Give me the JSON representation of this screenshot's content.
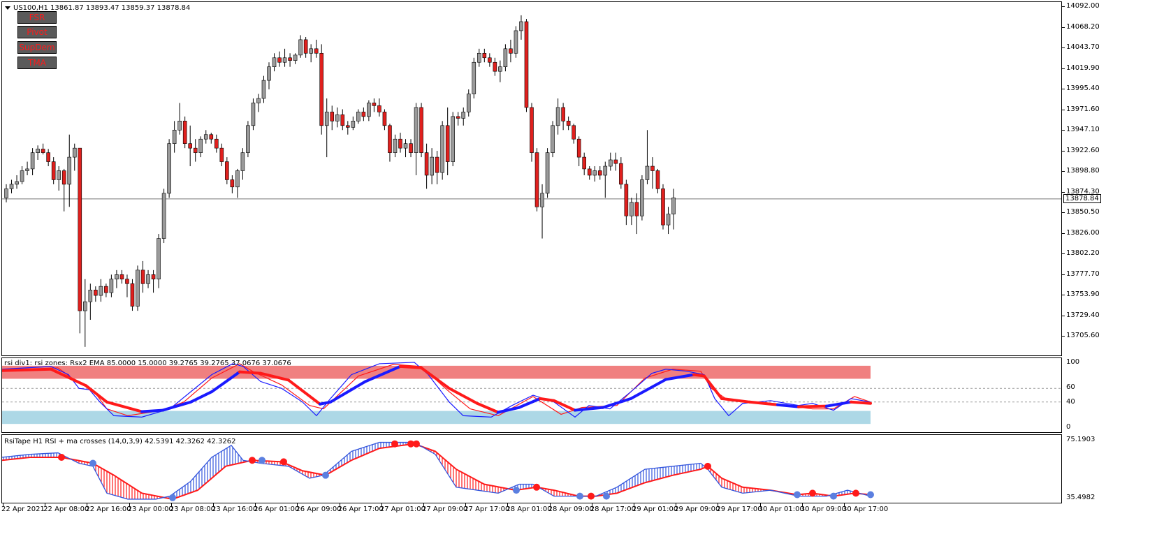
{
  "colors": {
    "bull_candle": "#9a9a9a",
    "bear_candle": "#e0201e",
    "rsx_up": "#1a1aff",
    "rsx_down": "#ff1a1a",
    "upper_zone": "#f08080",
    "lower_zone": "#add8e6",
    "rsi_line": "#3355dd",
    "ma_line": "#ff1a1a",
    "dot_blue": "#5b7fe0",
    "dot_red": "#ff1a1a"
  },
  "main": {
    "title": "US100,H1  13861.87 13893.47 13859.37 13878.84",
    "buttons": [
      "FSR",
      "Pivot",
      "SupDem",
      "TMA"
    ],
    "current_price": "13878.84",
    "y_labels": [
      "14092.00",
      "14068.20",
      "14043.70",
      "14019.90",
      "13995.40",
      "13971.60",
      "13947.10",
      "13922.60",
      "13898.80",
      "13874.30",
      "13850.50",
      "13826.00",
      "13802.20",
      "13777.70",
      "13753.90",
      "13729.40",
      "13705.60"
    ]
  },
  "ind1": {
    "title": "rsi div1: rsi zones: Rsx2 EMA 85.0000 15.0000 39.2765 39.2765 37.0676 37.0676",
    "y_labels": [
      "100",
      "60",
      "40",
      "0"
    ]
  },
  "ind2": {
    "title": "RsiTape H1 RSI + ma crosses (14,0,3,9) 42.5391 42.3262 42.3262",
    "y_labels": [
      "75.1903",
      "35.4982"
    ]
  },
  "x_labels": [
    "22 Apr 2021",
    "22 Apr 08:00",
    "22 Apr 16:00",
    "23 Apr 00:00",
    "23 Apr 08:00",
    "23 Apr 16:00",
    "26 Apr 01:00",
    "26 Apr 09:00",
    "26 Apr 17:00",
    "27 Apr 01:00",
    "27 Apr 09:00",
    "27 Apr 17:00",
    "28 Apr 01:00",
    "28 Apr 09:00",
    "28 Apr 17:00",
    "29 Apr 01:00",
    "29 Apr 09:00",
    "29 Apr 17:00",
    "30 Apr 01:00",
    "30 Apr 09:00",
    "30 Apr 17:00"
  ],
  "chart_data": {
    "type": "candlestick",
    "ohlc": [
      [
        13880,
        13895,
        13875,
        13890
      ],
      [
        13890,
        13900,
        13885,
        13895
      ],
      [
        13895,
        13905,
        13890,
        13898
      ],
      [
        13898,
        13915,
        13895,
        13910
      ],
      [
        13910,
        13920,
        13905,
        13912
      ],
      [
        13912,
        13935,
        13905,
        13930
      ],
      [
        13930,
        13938,
        13922,
        13934
      ],
      [
        13934,
        13940,
        13928,
        13930
      ],
      [
        13930,
        13934,
        13915,
        13920
      ],
      [
        13920,
        13925,
        13895,
        13900
      ],
      [
        13900,
        13915,
        13888,
        13910
      ],
      [
        13910,
        13912,
        13865,
        13895
      ],
      [
        13895,
        13950,
        13870,
        13925
      ],
      [
        13925,
        13940,
        13910,
        13935
      ],
      [
        13935,
        13935,
        13730,
        13755
      ],
      [
        13755,
        13790,
        13715,
        13765
      ],
      [
        13765,
        13785,
        13745,
        13778
      ],
      [
        13778,
        13782,
        13765,
        13772
      ],
      [
        13772,
        13790,
        13765,
        13782
      ],
      [
        13782,
        13785,
        13770,
        13775
      ],
      [
        13775,
        13795,
        13770,
        13790
      ],
      [
        13790,
        13800,
        13780,
        13795
      ],
      [
        13795,
        13800,
        13785,
        13790
      ],
      [
        13790,
        13795,
        13770,
        13785
      ],
      [
        13785,
        13790,
        13755,
        13760
      ],
      [
        13760,
        13805,
        13755,
        13800
      ],
      [
        13800,
        13810,
        13775,
        13785
      ],
      [
        13785,
        13800,
        13780,
        13795
      ],
      [
        13795,
        13800,
        13775,
        13790
      ],
      [
        13790,
        13840,
        13780,
        13835
      ],
      [
        13835,
        13890,
        13830,
        13885
      ],
      [
        13885,
        13945,
        13880,
        13940
      ],
      [
        13940,
        13965,
        13930,
        13955
      ],
      [
        13955,
        13985,
        13950,
        13965
      ],
      [
        13965,
        13970,
        13935,
        13940
      ],
      [
        13940,
        13960,
        13915,
        13935
      ],
      [
        13935,
        13945,
        13920,
        13930
      ],
      [
        13930,
        13948,
        13925,
        13945
      ],
      [
        13945,
        13955,
        13940,
        13950
      ],
      [
        13950,
        13952,
        13940,
        13945
      ],
      [
        13945,
        13950,
        13930,
        13935
      ],
      [
        13935,
        13940,
        13915,
        13920
      ],
      [
        13920,
        13925,
        13895,
        13900
      ],
      [
        13900,
        13905,
        13885,
        13892
      ],
      [
        13892,
        13912,
        13880,
        13910
      ],
      [
        13910,
        13935,
        13900,
        13930
      ],
      [
        13930,
        13965,
        13925,
        13960
      ],
      [
        13960,
        13990,
        13955,
        13985
      ],
      [
        13985,
        13995,
        13975,
        13990
      ],
      [
        13990,
        14015,
        13985,
        14010
      ],
      [
        14010,
        14030,
        14000,
        14025
      ],
      [
        14025,
        14040,
        14020,
        14035
      ],
      [
        14035,
        14042,
        14025,
        14030
      ],
      [
        14030,
        14045,
        14025,
        14035
      ],
      [
        14035,
        14040,
        14025,
        14032
      ],
      [
        14032,
        14040,
        14028,
        14038
      ],
      [
        14038,
        14060,
        14035,
        14055
      ],
      [
        14055,
        14058,
        14035,
        14040
      ],
      [
        14040,
        14050,
        14030,
        14045
      ],
      [
        14045,
        14055,
        14035,
        14040
      ],
      [
        14040,
        14050,
        13950,
        13960
      ],
      [
        13960,
        13990,
        13925,
        13975
      ],
      [
        13975,
        13982,
        13955,
        13965
      ],
      [
        13965,
        13980,
        13958,
        13972
      ],
      [
        13972,
        13978,
        13955,
        13960
      ],
      [
        13960,
        13965,
        13950,
        13958
      ],
      [
        13958,
        13970,
        13955,
        13965
      ],
      [
        13965,
        13978,
        13962,
        13975
      ],
      [
        13975,
        13980,
        13965,
        13970
      ],
      [
        13970,
        13988,
        13965,
        13985
      ],
      [
        13985,
        13990,
        13975,
        13982
      ],
      [
        13982,
        13990,
        13970,
        13975
      ],
      [
        13975,
        13978,
        13955,
        13960
      ],
      [
        13960,
        13962,
        13920,
        13930
      ],
      [
        13930,
        13950,
        13925,
        13945
      ],
      [
        13945,
        13952,
        13930,
        13935
      ],
      [
        13935,
        13945,
        13925,
        13940
      ],
      [
        13940,
        13945,
        13925,
        13930
      ],
      [
        13930,
        13985,
        13905,
        13980
      ],
      [
        13980,
        13985,
        13925,
        13930
      ],
      [
        13930,
        13940,
        13890,
        13905
      ],
      [
        13905,
        13935,
        13895,
        13925
      ],
      [
        13925,
        13932,
        13895,
        13908
      ],
      [
        13908,
        13965,
        13900,
        13960
      ],
      [
        13960,
        13980,
        13905,
        13920
      ],
      [
        13920,
        13975,
        13915,
        13970
      ],
      [
        13970,
        13975,
        13960,
        13968
      ],
      [
        13968,
        13980,
        13960,
        13975
      ],
      [
        13975,
        14000,
        13970,
        13995
      ],
      [
        13995,
        14035,
        13990,
        14030
      ],
      [
        14030,
        14045,
        14025,
        14040
      ],
      [
        14040,
        14045,
        14030,
        14035
      ],
      [
        14035,
        14040,
        14025,
        14030
      ],
      [
        14030,
        14035,
        14015,
        14020
      ],
      [
        14020,
        14032,
        14008,
        14025
      ],
      [
        14025,
        14050,
        14020,
        14045
      ],
      [
        14045,
        14055,
        14030,
        14040
      ],
      [
        14040,
        14070,
        14035,
        14065
      ],
      [
        14065,
        14082,
        14055,
        14075
      ],
      [
        14075,
        14078,
        13975,
        13980
      ],
      [
        13980,
        13985,
        13920,
        13930
      ],
      [
        13930,
        13935,
        13865,
        13870
      ],
      [
        13870,
        13895,
        13835,
        13885
      ],
      [
        13885,
        13935,
        13880,
        13930
      ],
      [
        13930,
        13965,
        13925,
        13960
      ],
      [
        13960,
        13990,
        13950,
        13980
      ],
      [
        13980,
        13985,
        13955,
        13965
      ],
      [
        13965,
        13970,
        13955,
        13960
      ],
      [
        13960,
        13962,
        13940,
        13945
      ],
      [
        13945,
        13948,
        13915,
        13925
      ],
      [
        13925,
        13930,
        13905,
        13912
      ],
      [
        13912,
        13915,
        13900,
        13905
      ],
      [
        13905,
        13915,
        13898,
        13910
      ],
      [
        13910,
        13915,
        13900,
        13905
      ],
      [
        13905,
        13920,
        13880,
        13915
      ],
      [
        13915,
        13930,
        13910,
        13922
      ],
      [
        13922,
        13930,
        13910,
        13918
      ],
      [
        13918,
        13925,
        13890,
        13895
      ],
      [
        13895,
        13900,
        13850,
        13860
      ],
      [
        13860,
        13880,
        13850,
        13875
      ],
      [
        13875,
        13885,
        13840,
        13860
      ],
      [
        13860,
        13905,
        13855,
        13900
      ],
      [
        13900,
        13955,
        13895,
        13915
      ],
      [
        13915,
        13925,
        13890,
        13910
      ],
      [
        13910,
        13912,
        13885,
        13890
      ],
      [
        13890,
        13895,
        13845,
        13850
      ],
      [
        13850,
        13870,
        13840,
        13862
      ],
      [
        13862,
        13890,
        13845,
        13880
      ]
    ]
  }
}
